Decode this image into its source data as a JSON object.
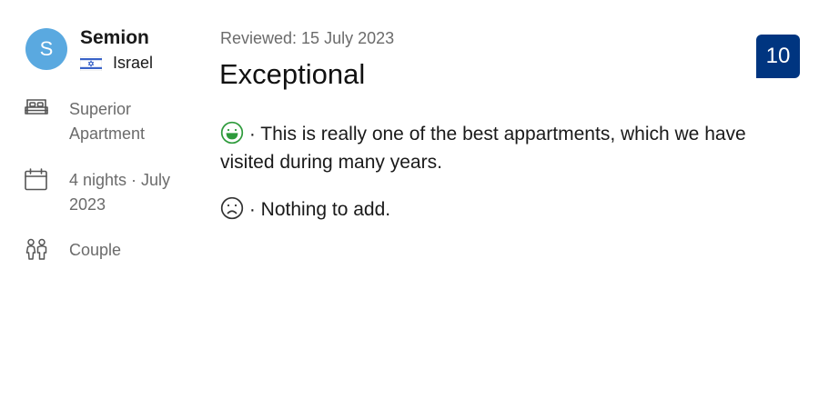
{
  "reviewer": {
    "avatar_initial": "S",
    "name": "Semion",
    "country": "Israel",
    "flag_icon": "israel-flag-icon"
  },
  "stay": {
    "room_type": "Superior Apartment",
    "duration": "4 nights · July 2023",
    "traveler_type": "Couple",
    "icons": [
      "bed-icon",
      "calendar-icon",
      "couple-icon"
    ]
  },
  "review": {
    "reviewed_date": "Reviewed: 15 July 2023",
    "headline": "Exceptional",
    "score": "10",
    "positive_text": "· This is really one of the best appartments, which we have visited during many years.",
    "negative_text": "· Nothing to add."
  },
  "colors": {
    "avatar_bg": "#5aa9e0",
    "score_bg": "#003580",
    "positive_icon": "#2e9b3c",
    "negative_icon": "#333333",
    "muted_text": "#6b6b6b"
  }
}
